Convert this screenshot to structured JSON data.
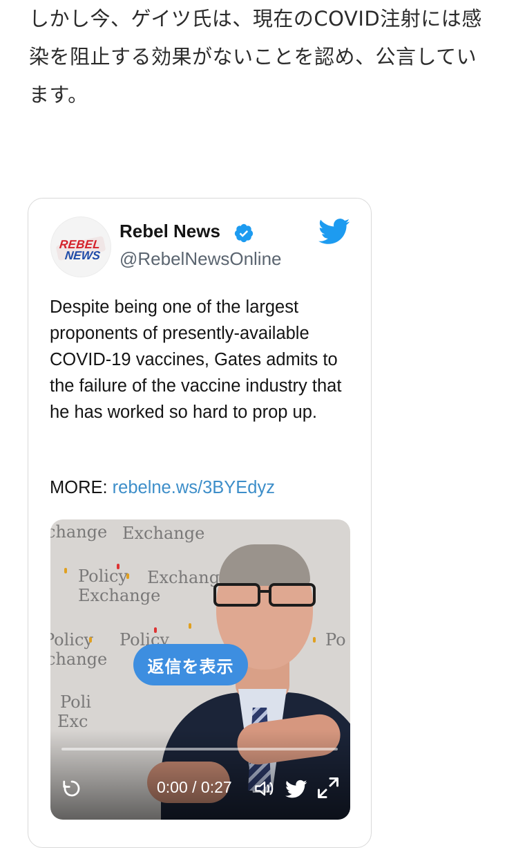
{
  "article": {
    "paragraph": "しかし今、ゲイツ氏は、現在のCOVID注射には感染を阻止する効果がないことを認め、公言しています。"
  },
  "tweet": {
    "avatar_text_1": "REBEL",
    "avatar_text_2": "NEWS",
    "display_name": "Rebel News",
    "handle": "@RebelNewsOnline",
    "body": "Despite being one of the largest proponents of presently-available COVID-19 vaccines, Gates admits to the failure of the vaccine industry that he has worked so hard to prop up.",
    "more_label": "MORE: ",
    "more_link": "rebelne.ws/3BYEdyz",
    "icons": {
      "verified": "verified-badge-icon",
      "twitter": "twitter-bird-icon"
    },
    "colors": {
      "link": "#3d8ec9",
      "verified": "#1d9bf0",
      "twitter": "#1d9bf0"
    }
  },
  "video": {
    "background_texts": [
      "change",
      "Exchange",
      "Policy",
      "Exchange",
      "Policy",
      "Exchange",
      "change",
      "Policy",
      "Exc",
      "Poli",
      "Po"
    ],
    "reply_button_label": "返信を表示",
    "time_display": "0:00 / 0:27",
    "progress": 0,
    "icons": [
      "replay-icon",
      "volume-icon",
      "twitter-icon",
      "fullscreen-icon"
    ]
  }
}
